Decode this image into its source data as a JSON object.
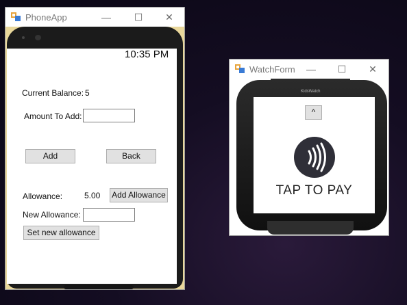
{
  "phone_window": {
    "title": "PhoneApp",
    "minimize_glyph": "—",
    "maximize_glyph": "☐",
    "close_glyph": "✕",
    "time": "10:35 PM",
    "current_balance_label": "Current Balance:",
    "current_balance_value": "5",
    "amount_to_add_label": "Amount To Add:",
    "amount_to_add_value": "",
    "add_button": "Add",
    "back_button": "Back",
    "allowance_label": "Allowance:",
    "allowance_value": "5.00",
    "add_allowance_button": "Add Allowance",
    "new_allowance_label": "New Allowance:",
    "new_allowance_value": "",
    "set_new_allowance_button": "Set new allowance"
  },
  "watch_window": {
    "title": "WatchForm",
    "minimize_glyph": "—",
    "maximize_glyph": "☐",
    "close_glyph": "✕",
    "brand": "KidsWatch",
    "up_button": "^",
    "tap_to_pay": "TAP TO PAY"
  },
  "icons": [
    "app-icon",
    "contactless-pay-icon"
  ]
}
